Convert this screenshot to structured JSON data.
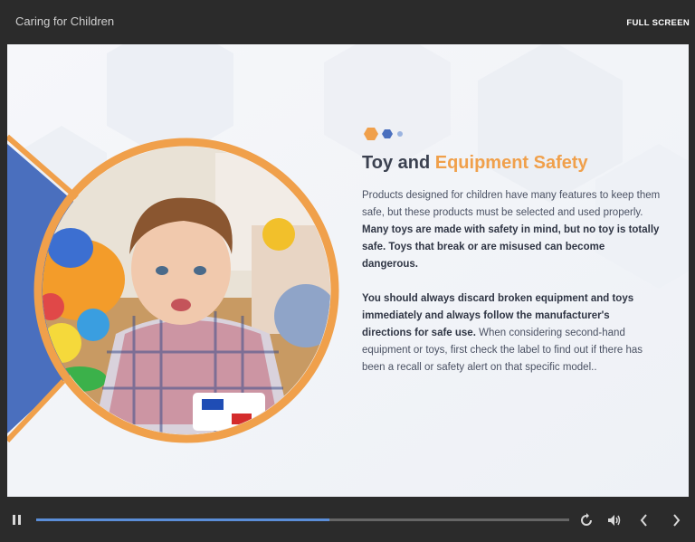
{
  "app": {
    "title": "Caring for Children",
    "fullscreen_label": "FULL SCREEN"
  },
  "slide": {
    "heading_part1": "Toy and ",
    "heading_part2": "Equipment Safety",
    "paragraph1_normal": "Products designed for children have many features to keep them safe, but these products must be selected and used properly. ",
    "paragraph1_bold": "Many toys are made with safety in mind, but no toy is totally safe. Toys that break or are misused can become dangerous.",
    "paragraph2_bold": "You should always discard broken equipment and toys immediately and always follow the manufacturer's directions for safe use.",
    "paragraph2_normal": " When considering second-hand equipment or toys, first check the label to find out if there has been a recall or safety alert on that specific model..",
    "image_alt": "Toddler playing with colorful toys"
  },
  "player": {
    "progress_fraction": 0.55,
    "icons": [
      "pause-icon",
      "replay-icon",
      "volume-icon",
      "chevron-left-icon",
      "chevron-right-icon"
    ]
  },
  "colors": {
    "accent_orange": "#f0a04b",
    "accent_blue": "#4a6fbe",
    "progress_blue": "#5b8ed8",
    "chrome": "#2b2b2b"
  }
}
